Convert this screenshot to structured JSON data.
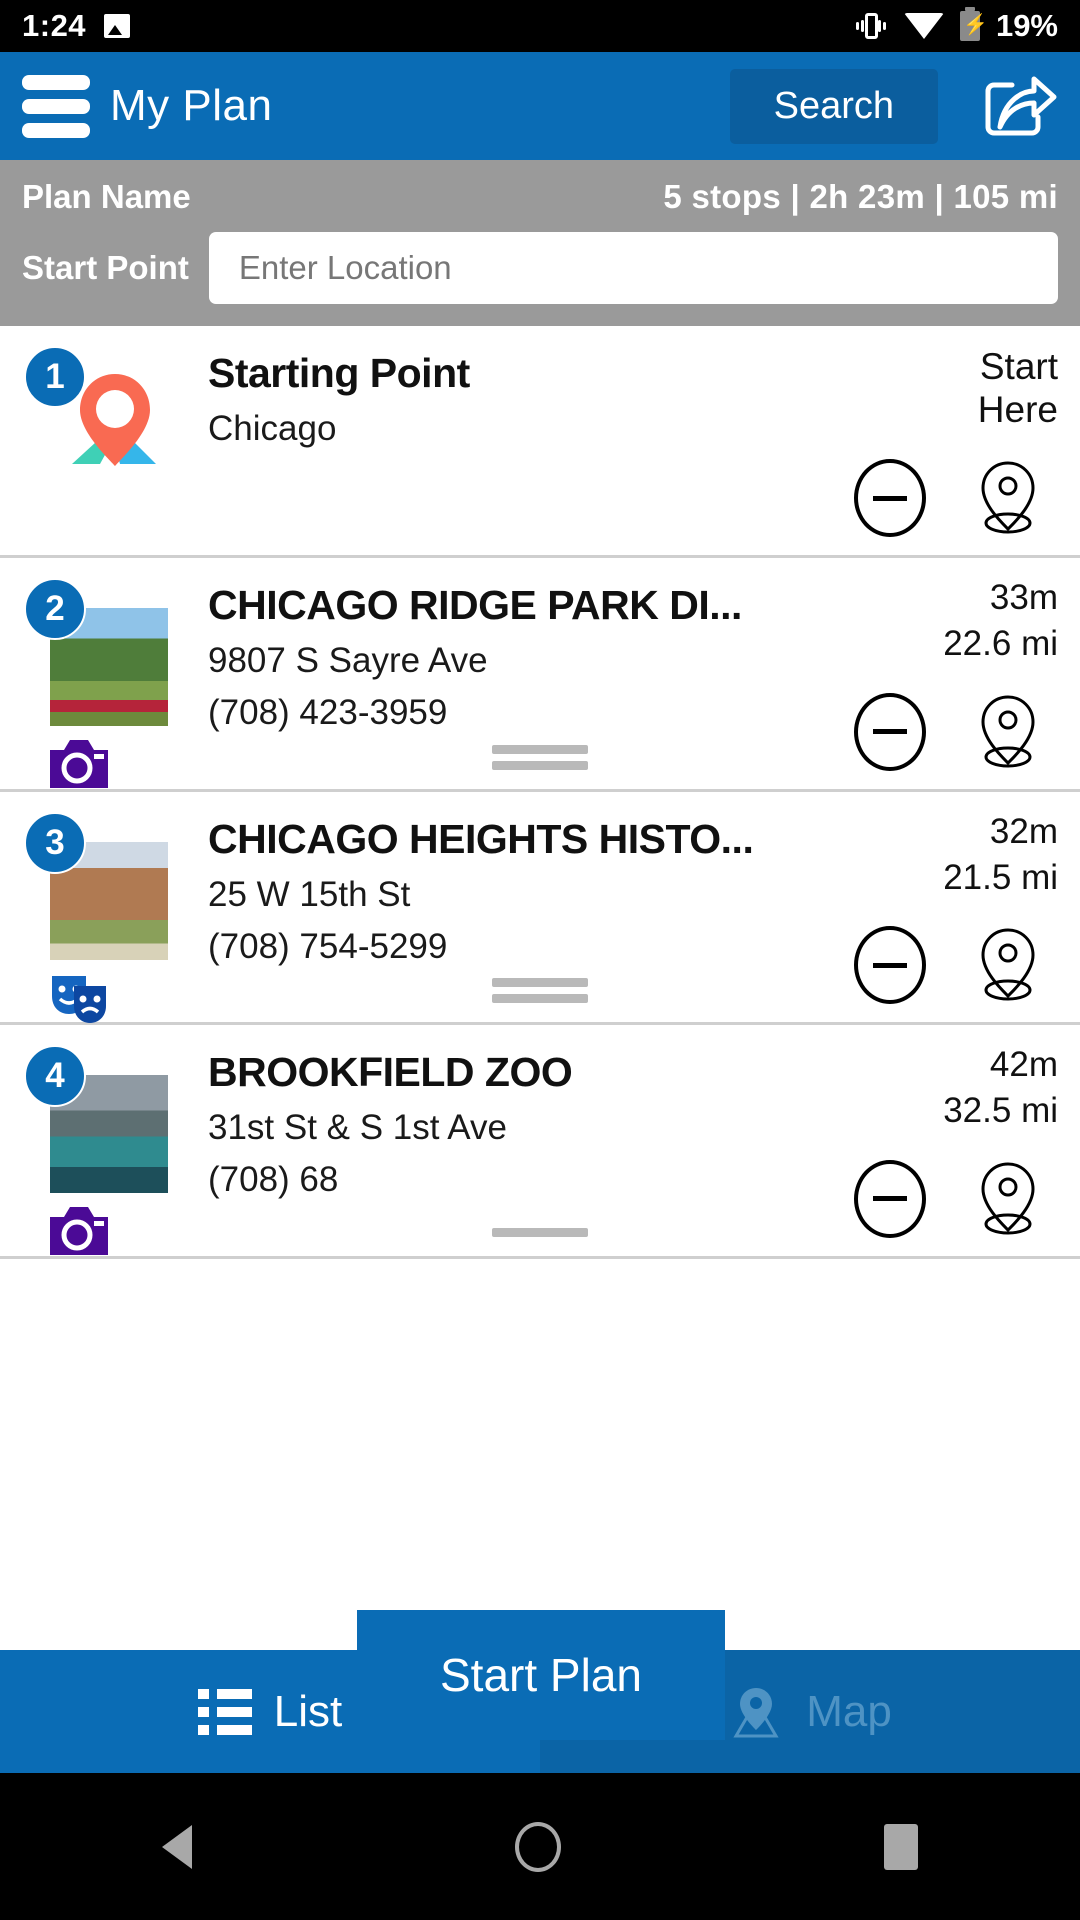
{
  "status_bar": {
    "time": "1:24",
    "battery_percent": "19%",
    "icons": [
      "image-icon",
      "vibrate-icon",
      "wifi-icon",
      "battery-charging-icon"
    ]
  },
  "app_bar": {
    "menu_icon": "hamburger-menu-icon",
    "title": "My Plan",
    "search_label": "Search",
    "share_icon": "share-icon"
  },
  "plan_bar": {
    "plan_name_label": "Plan Name",
    "stats": "5 stops  |  2h 23m  |  105 mi",
    "stops_count": "5 stops",
    "duration": "2h 23m",
    "distance": "105 mi",
    "start_point_label": "Start Point",
    "location_value": "",
    "location_placeholder": "Enter Location"
  },
  "stops": [
    {
      "number": "1",
      "title": "Starting Point",
      "address": "Chicago",
      "phone": "",
      "meta_primary": "Start",
      "meta_secondary": "Here",
      "is_start": true,
      "thumb_kind": "map-pin-graphic",
      "category_icon": "",
      "remove_icon": "minus-circle-icon",
      "locate_icon": "map-pin-icon",
      "has_drag_handle": false
    },
    {
      "number": "2",
      "title": "CHICAGO RIDGE PARK DI...",
      "address": "9807 S Sayre Ave",
      "phone": "(708) 423-3959",
      "meta_primary": "33m",
      "meta_secondary": "22.6 mi",
      "is_start": false,
      "thumb_kind": "ph-park",
      "category_icon": "camera-icon",
      "remove_icon": "minus-circle-icon",
      "locate_icon": "map-pin-icon",
      "has_drag_handle": true
    },
    {
      "number": "3",
      "title": "CHICAGO HEIGHTS HISTO...",
      "address": "25 W 15th St",
      "phone": "(708) 754-5299",
      "meta_primary": "32m",
      "meta_secondary": "21.5 mi",
      "is_start": false,
      "thumb_kind": "ph-hist",
      "category_icon": "theater-masks-icon",
      "remove_icon": "minus-circle-icon",
      "locate_icon": "map-pin-icon",
      "has_drag_handle": true
    },
    {
      "number": "4",
      "title": "BROOKFIELD ZOO",
      "address": "31st St & S 1st Ave",
      "phone": "(708) 68",
      "meta_primary": "42m",
      "meta_secondary": "32.5 mi",
      "is_start": false,
      "thumb_kind": "ph-zoo",
      "category_icon": "camera-icon",
      "remove_icon": "minus-circle-icon",
      "locate_icon": "map-pin-icon",
      "has_drag_handle": true
    }
  ],
  "start_plan_button": {
    "label": "Start Plan"
  },
  "bottom_tabs": [
    {
      "label": "List",
      "icon": "list-icon",
      "active": true
    },
    {
      "label": "Map",
      "icon": "map-marker-icon",
      "active": false
    }
  ],
  "nav_bar": {
    "back_icon": "back-triangle-icon",
    "home_icon": "home-circle-icon",
    "recents_icon": "recents-square-icon"
  },
  "colors": {
    "brand_blue": "#0a6cb5",
    "header_button_blue": "#0b5e9e",
    "plan_bar_gray": "#9a9a9a",
    "camera_purple": "#4b0a96",
    "masks_blue": "#1565c0",
    "pin_orange": "#f96a52"
  }
}
